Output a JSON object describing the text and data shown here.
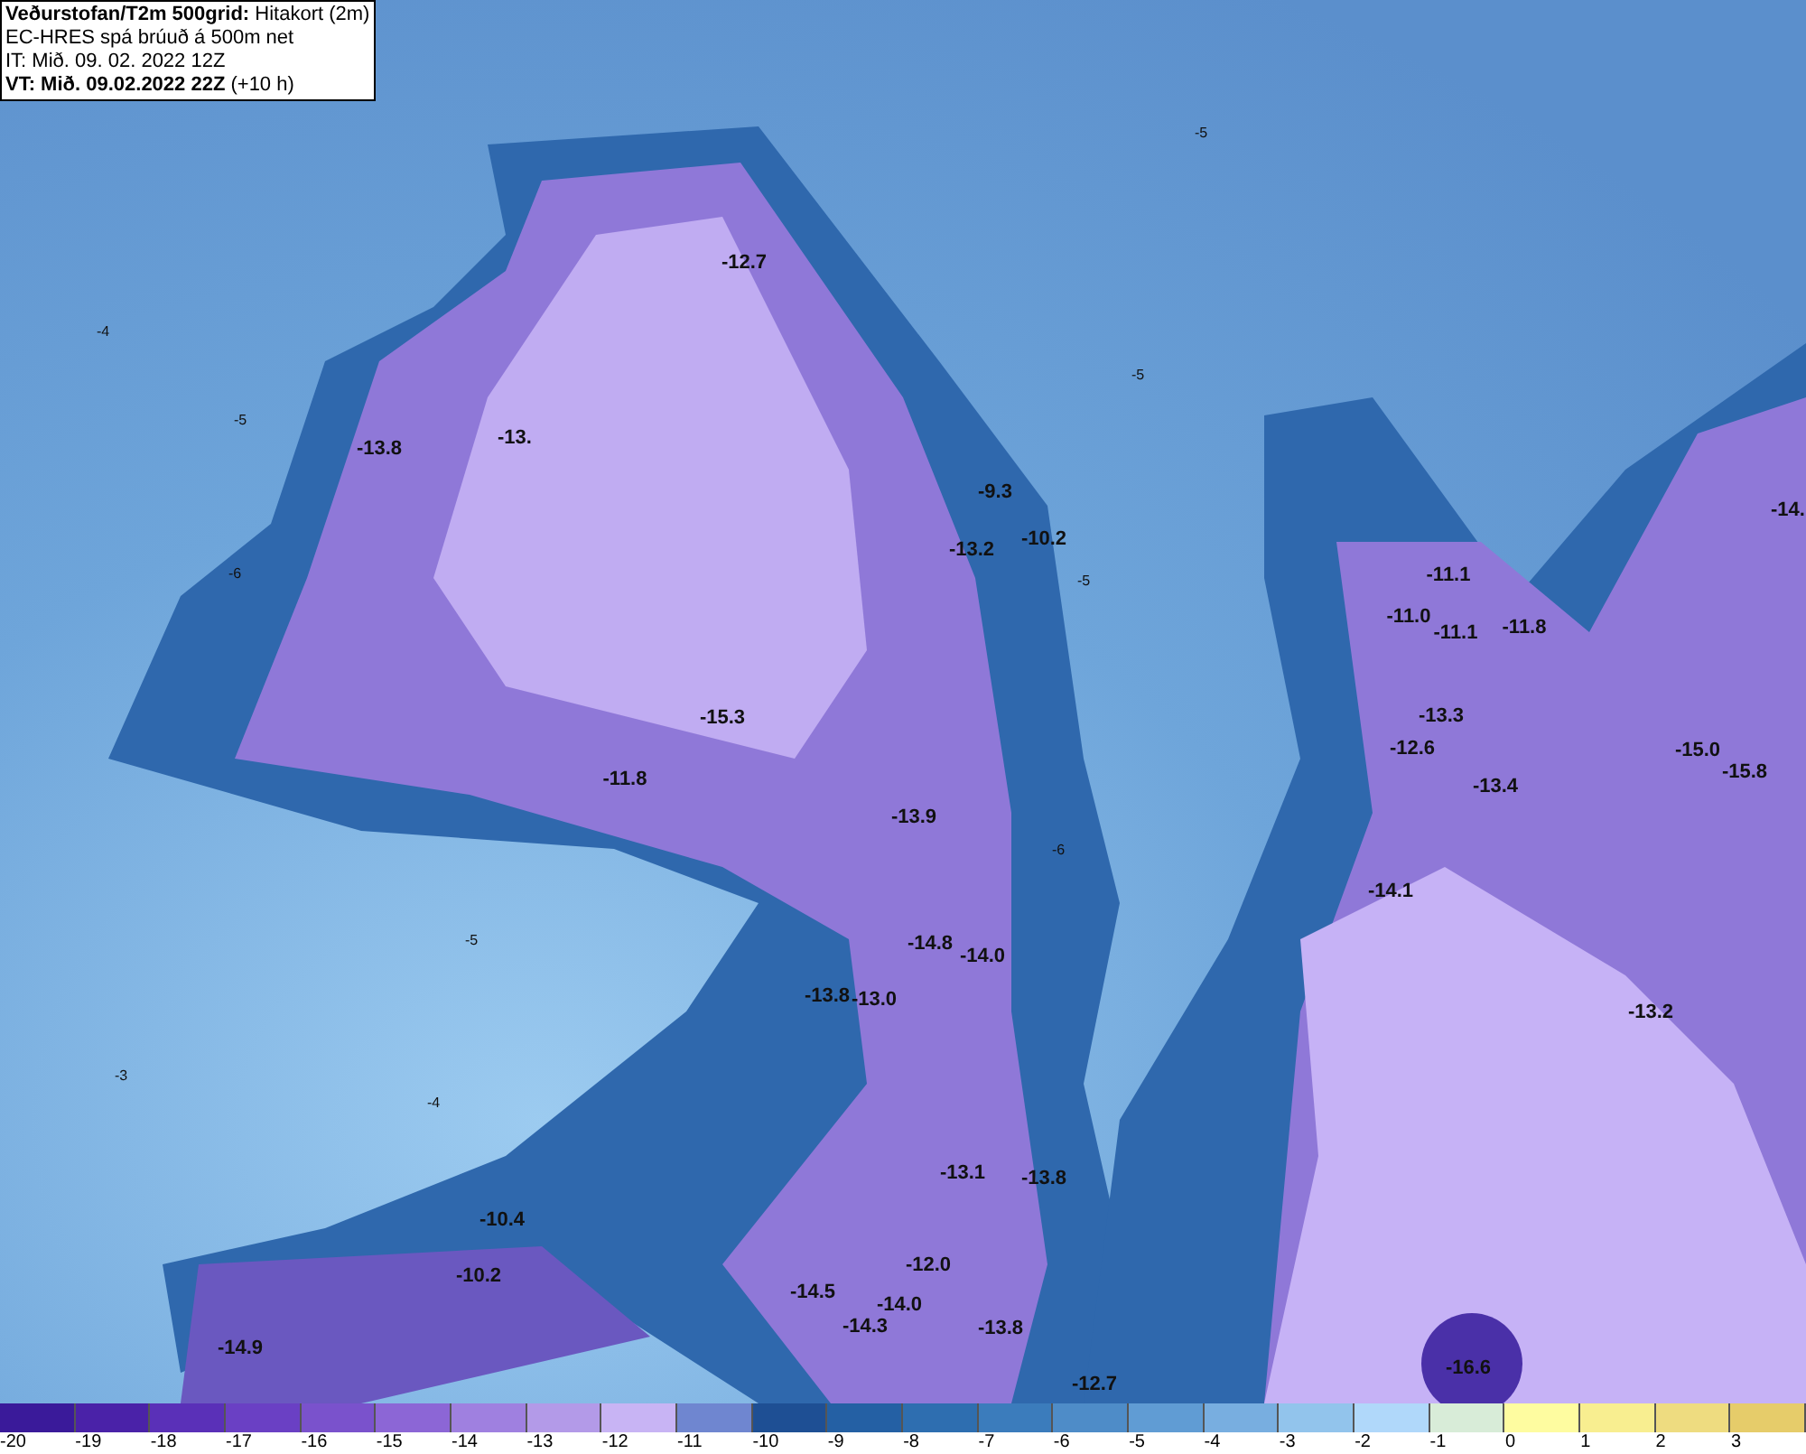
{
  "header": {
    "lines": [
      "**Veðurstofan/T2m 500grid:** Hitakort (2m)",
      "EC-HRES spá brúuð á 500m net",
      "IT: Mið. 09. 02. 2022 12Z",
      "**VT: Mið. 09.02.2022 22Z** (+10 h)"
    ]
  },
  "map": {
    "labels": [
      {
        "text": "-12.7",
        "kind": "value"
      },
      {
        "text": "-13.8",
        "kind": "value"
      },
      {
        "text": "-13.",
        "kind": "value"
      },
      {
        "text": "-9.3",
        "kind": "value"
      },
      {
        "text": "-13.2",
        "kind": "value"
      },
      {
        "text": "-10.2",
        "kind": "value"
      },
      {
        "text": "-15.3",
        "kind": "value"
      },
      {
        "text": "-11.8",
        "kind": "value"
      },
      {
        "text": "-13.9",
        "kind": "value"
      },
      {
        "text": "-14.8",
        "kind": "value"
      },
      {
        "text": "-14.0",
        "kind": "value"
      },
      {
        "text": "-13.8",
        "kind": "value"
      },
      {
        "text": "-13.0",
        "kind": "value"
      },
      {
        "text": "-13.1",
        "kind": "value"
      },
      {
        "text": "-13.8",
        "kind": "value"
      },
      {
        "text": "-12.0",
        "kind": "value"
      },
      {
        "text": "-14.5",
        "kind": "value"
      },
      {
        "text": "-14.0",
        "kind": "value"
      },
      {
        "text": "-14.3",
        "kind": "value"
      },
      {
        "text": "-13.8",
        "kind": "value"
      },
      {
        "text": "-12.7",
        "kind": "value"
      },
      {
        "text": "-10.4",
        "kind": "value"
      },
      {
        "text": "-10.2",
        "kind": "value"
      },
      {
        "text": "-14.9",
        "kind": "value"
      },
      {
        "text": "-11.1",
        "kind": "value"
      },
      {
        "text": "-11.0",
        "kind": "value"
      },
      {
        "text": "-11.1",
        "kind": "value"
      },
      {
        "text": "-11.8",
        "kind": "value"
      },
      {
        "text": "-13.3",
        "kind": "value"
      },
      {
        "text": "-12.6",
        "kind": "value"
      },
      {
        "text": "-13.4",
        "kind": "value"
      },
      {
        "text": "-14.1",
        "kind": "value"
      },
      {
        "text": "-15.0",
        "kind": "value"
      },
      {
        "text": "-15.8",
        "kind": "value"
      },
      {
        "text": "-14.",
        "kind": "value"
      },
      {
        "text": "-13.2",
        "kind": "value"
      },
      {
        "text": "-16.6",
        "kind": "value"
      },
      {
        "text": "-5",
        "kind": "contour"
      },
      {
        "text": "-4",
        "kind": "contour"
      },
      {
        "text": "-5",
        "kind": "contour"
      },
      {
        "text": "-6",
        "kind": "contour"
      },
      {
        "text": "-5",
        "kind": "contour"
      },
      {
        "text": "-4",
        "kind": "contour"
      },
      {
        "text": "-3",
        "kind": "contour"
      },
      {
        "text": "-5",
        "kind": "contour"
      },
      {
        "text": "-6",
        "kind": "contour"
      },
      {
        "text": "-5",
        "kind": "contour"
      }
    ]
  },
  "legend": [
    {
      "label": "-20",
      "color": "#3a1a9a"
    },
    {
      "label": "-19",
      "color": "#4a22a8"
    },
    {
      "label": "-18",
      "color": "#5a30b8"
    },
    {
      "label": "-17",
      "color": "#6a40c4"
    },
    {
      "label": "-16",
      "color": "#7a52cc"
    },
    {
      "label": "-15",
      "color": "#8c66d6"
    },
    {
      "label": "-14",
      "color": "#9f80e0"
    },
    {
      "label": "-13",
      "color": "#b39ae8"
    },
    {
      "label": "-12",
      "color": "#c8b4f4"
    },
    {
      "label": "-11",
      "color": "#6f86d0"
    },
    {
      "label": "-10",
      "color": "#1e4f94"
    },
    {
      "label": "-9",
      "color": "#2460a4"
    },
    {
      "label": "-8",
      "color": "#2e6eb0"
    },
    {
      "label": "-7",
      "color": "#3b7cbc"
    },
    {
      "label": "-6",
      "color": "#4e8cc8"
    },
    {
      "label": "-5",
      "color": "#609cd4"
    },
    {
      "label": "-4",
      "color": "#78aee0"
    },
    {
      "label": "-3",
      "color": "#92c4ec"
    },
    {
      "label": "-2",
      "color": "#b0d8fa"
    },
    {
      "label": "-1",
      "color": "#d8ecd8"
    },
    {
      "label": "0",
      "color": "#fefca0"
    },
    {
      "label": "1",
      "color": "#f8ee90"
    },
    {
      "label": "2",
      "color": "#eedc80"
    },
    {
      "label": "3",
      "color": "#e6cc6a"
    }
  ]
}
